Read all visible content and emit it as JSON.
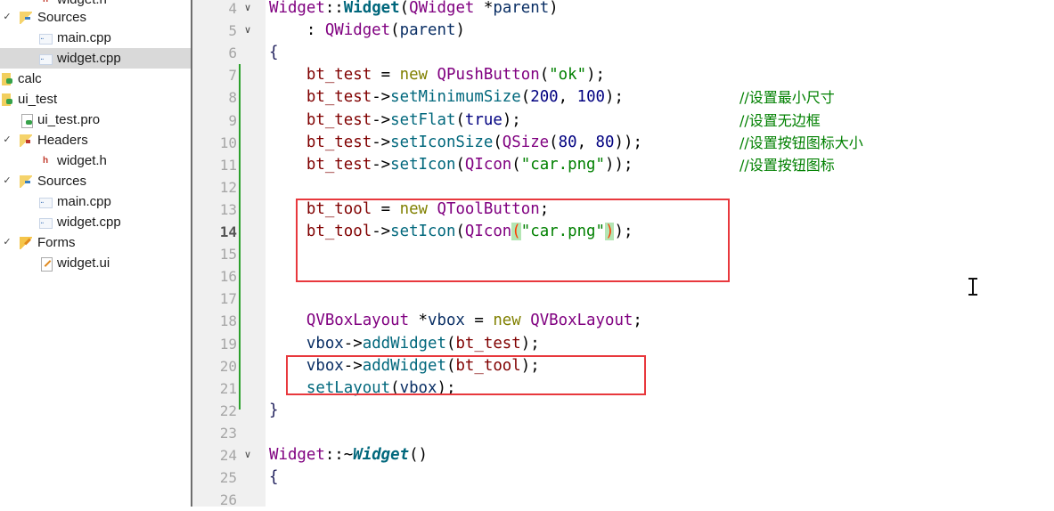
{
  "project_tree": {
    "items": [
      {
        "label": "widget.h",
        "type": "header-file",
        "level": 2,
        "partial": true
      },
      {
        "label": "Sources",
        "type": "sources-folder",
        "level": 1,
        "expanded": true
      },
      {
        "label": "main.cpp",
        "type": "cpp-file",
        "level": 2
      },
      {
        "label": "widget.cpp",
        "type": "cpp-file",
        "level": 2,
        "selected": true
      },
      {
        "label": "calc",
        "type": "project",
        "level": 0
      },
      {
        "label": "ui_test",
        "type": "project",
        "level": 0
      },
      {
        "label": "ui_test.pro",
        "type": "pro-file",
        "level": 1
      },
      {
        "label": "Headers",
        "type": "headers-folder",
        "level": 1,
        "expanded": true
      },
      {
        "label": "widget.h",
        "type": "header-file",
        "level": 2
      },
      {
        "label": "Sources",
        "type": "sources-folder",
        "level": 1,
        "expanded": true
      },
      {
        "label": "main.cpp",
        "type": "cpp-file",
        "level": 2
      },
      {
        "label": "widget.cpp",
        "type": "cpp-file",
        "level": 2
      },
      {
        "label": "Forms",
        "type": "forms-folder",
        "level": 1,
        "expanded": true
      },
      {
        "label": "widget.ui",
        "type": "ui-file",
        "level": 2
      }
    ]
  },
  "editor": {
    "current_line": 14,
    "lines": [
      {
        "n": "4",
        "fold": true,
        "text": "Widget::Widget(QWidget *parent)"
      },
      {
        "n": "5",
        "fold": true,
        "text": "    : QWidget(parent)"
      },
      {
        "n": "6",
        "text": "{"
      },
      {
        "n": "7",
        "text": "    bt_test = new QPushButton(\"ok\");"
      },
      {
        "n": "8",
        "text": "    bt_test->setMinimumSize(200, 100);",
        "comment": "//设置最小尺寸"
      },
      {
        "n": "9",
        "text": "    bt_test->setFlat(true);",
        "comment": "//设置无边框"
      },
      {
        "n": "10",
        "text": "    bt_test->setIconSize(QSize(80, 80));",
        "comment": "//设置按钮图标大小"
      },
      {
        "n": "11",
        "text": "    bt_test->setIcon(QIcon(\"car.png\"));",
        "comment": "//设置按钮图标"
      },
      {
        "n": "12",
        "text": ""
      },
      {
        "n": "13",
        "text": "    bt_tool = new QToolButton;"
      },
      {
        "n": "14",
        "text": "    bt_tool->setIcon(QIcon(\"car.png\"));"
      },
      {
        "n": "15",
        "text": ""
      },
      {
        "n": "16",
        "text": ""
      },
      {
        "n": "17",
        "text": ""
      },
      {
        "n": "18",
        "text": "    QVBoxLayout *vbox = new QVBoxLayout;"
      },
      {
        "n": "19",
        "text": "    vbox->addWidget(bt_test);"
      },
      {
        "n": "20",
        "text": "    vbox->addWidget(bt_tool);"
      },
      {
        "n": "21",
        "text": "    setLayout(vbox);"
      },
      {
        "n": "22",
        "text": "}"
      },
      {
        "n": "23",
        "text": ""
      },
      {
        "n": "24",
        "fold": true,
        "text": "Widget::~Widget()"
      },
      {
        "n": "25",
        "text": "{"
      },
      {
        "n": "26",
        "text": ""
      }
    ],
    "tokens": {
      "l4": [
        "Widget",
        "::",
        "Widget",
        "(",
        "QWidget",
        " *",
        "parent",
        ")"
      ],
      "l5": [
        "    : ",
        "QWidget",
        "(",
        "parent",
        ")"
      ],
      "l7": [
        "    ",
        "bt_test",
        " = ",
        "new",
        " ",
        "QPushButton",
        "(",
        "\"ok\"",
        ");"
      ],
      "l8": [
        "    ",
        "bt_test",
        "->",
        "setMinimumSize",
        "(",
        "200",
        ", ",
        "100",
        ");"
      ],
      "l9": [
        "    ",
        "bt_test",
        "->",
        "setFlat",
        "(",
        "true",
        ");"
      ],
      "l10": [
        "    ",
        "bt_test",
        "->",
        "setIconSize",
        "(",
        "QSize",
        "(",
        "80",
        ", ",
        "80",
        "));"
      ],
      "l11": [
        "    ",
        "bt_test",
        "->",
        "setIcon",
        "(",
        "QIcon",
        "(",
        "\"car.png\"",
        "));"
      ],
      "l13": [
        "    ",
        "bt_tool",
        " = ",
        "new",
        " ",
        "QToolButton",
        ";"
      ],
      "l14": [
        "    ",
        "bt_tool",
        "->",
        "setIcon",
        "(",
        "QIcon",
        "(",
        "\"car.png\"",
        ")",
        ")",
        ";"
      ],
      "l18": [
        "    ",
        "QVBoxLayout",
        " *",
        "vbox",
        " = ",
        "new",
        " ",
        "QVBoxLayout",
        ";"
      ],
      "l19": [
        "    ",
        "vbox",
        "->",
        "addWidget",
        "(",
        "bt_test",
        ");"
      ],
      "l20": [
        "    ",
        "vbox",
        "->",
        "addWidget",
        "(",
        "bt_tool",
        ");"
      ],
      "l21": [
        "    ",
        "setLayout",
        "(",
        "vbox",
        ");"
      ],
      "l24": [
        "Widget",
        "::~",
        "Widget",
        "()"
      ]
    }
  },
  "annotations": [
    {
      "label": "highlight-box-tool-button",
      "covers_lines": [
        13,
        15
      ]
    },
    {
      "label": "highlight-box-add-widget",
      "covers_lines": [
        20
      ]
    }
  ],
  "colors": {
    "highlight_box": "#e8383d",
    "change_bar": "#2ca02c",
    "comment": "#008000",
    "class": "#800080",
    "function": "#00677c"
  }
}
